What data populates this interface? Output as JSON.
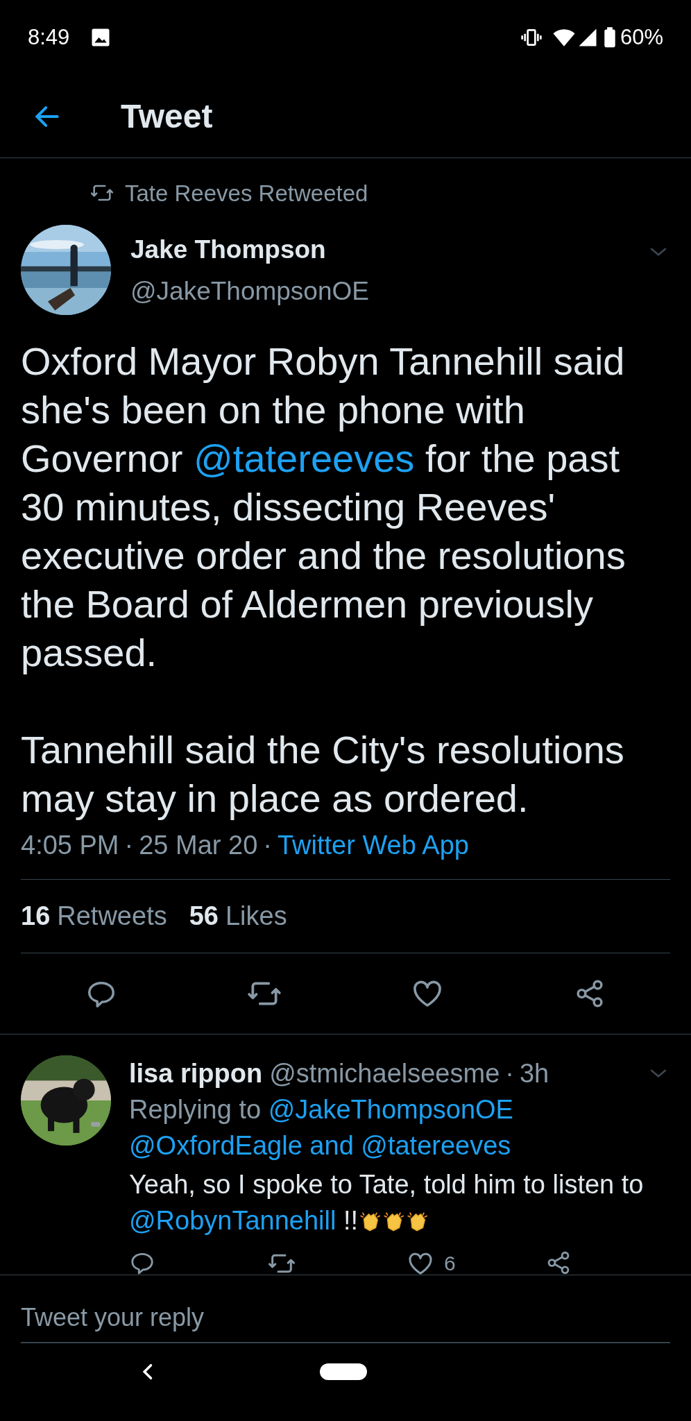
{
  "status_bar": {
    "time": "8:49",
    "battery": "60%"
  },
  "header": {
    "title": "Tweet"
  },
  "tweet": {
    "retweeted_by": "Tate Reeves Retweeted",
    "author": {
      "name": "Jake Thompson",
      "handle": "@JakeThompsonOE",
      "avatar": {
        "kind": "picture"
      }
    },
    "paragraphs": [
      [
        {
          "kind": "plain",
          "text": "Oxford Mayor Robyn Tannehill said she's been on the phone with Governor "
        },
        {
          "kind": "mention",
          "text": "@tatereeves"
        },
        {
          "kind": "plain",
          "text": " for the past 30 minutes, dissecting Reeves' executive order and the resolutions the Board of Aldermen previously passed."
        }
      ],
      [
        {
          "kind": "plain",
          "text": "Tannehill said the City's resolutions may stay in place as ordered."
        }
      ]
    ],
    "time": "4:05 PM",
    "separator": "·",
    "date": "25 Mar 20",
    "source": "Twitter Web App",
    "stats": [
      {
        "count": "16",
        "label": "Retweets"
      },
      {
        "count": "56",
        "label": "Likes"
      }
    ]
  },
  "replies": [
    {
      "name": "lisa rippon",
      "handle": "@stmichaelseesme",
      "separator": "·",
      "age": "3h",
      "avatar": {
        "kind": "picture"
      },
      "replying_to": "Replying to",
      "replying_mentions": [
        "@JakeThompsonOE",
        "@OxfordEagle and @tatereeves"
      ],
      "body": [
        {
          "kind": "plain",
          "text": "Yeah, so I spoke to Tate, told him to listen to "
        },
        {
          "kind": "mention",
          "text": "@RobynTannehill"
        },
        {
          "kind": "plain",
          "text": " !!"
        },
        {
          "kind": "clap"
        },
        {
          "kind": "clap"
        },
        {
          "kind": "clap"
        }
      ],
      "like_count": "6"
    }
  ],
  "compose": {
    "placeholder": "Tweet your reply"
  }
}
